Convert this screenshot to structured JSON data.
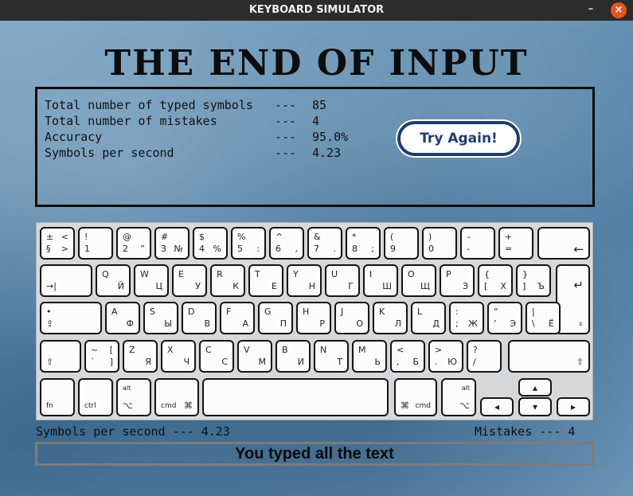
{
  "window": {
    "title": "KEYBOARD SIMULATOR",
    "minimize": "–",
    "close": "×"
  },
  "headline": "THE END OF INPUT",
  "stats": [
    {
      "label": "Total number of typed symbols",
      "sep": "---",
      "value": "85"
    },
    {
      "label": "Total number of mistakes",
      "sep": "---",
      "value": "4"
    },
    {
      "label": "Accuracy",
      "sep": "---",
      "value": "95.0%"
    },
    {
      "label": "Symbols per second",
      "sep": "---",
      "value": "4.23"
    }
  ],
  "try_again": "Try Again!",
  "footer": {
    "left": "Symbols per second --- 4.23",
    "right": "Mistakes --- 4"
  },
  "status": "You typed all the text",
  "keyboard": {
    "row1": [
      {
        "lt": "±",
        "lb": "§",
        "rt": "<",
        "rb": ">"
      },
      {
        "lt": "!",
        "lb": "1"
      },
      {
        "lt": "@",
        "lb": "2",
        "rb": "”"
      },
      {
        "lt": "#",
        "lb": "3",
        "rb": "№"
      },
      {
        "lt": "$",
        "lb": "4",
        "rb": "%"
      },
      {
        "lt": "%",
        "lb": "5",
        "rb": ":"
      },
      {
        "lt": "^",
        "lb": "6",
        "rb": ","
      },
      {
        "lt": "&",
        "lb": "7",
        "rb": "."
      },
      {
        "lt": "*",
        "lb": "8",
        "rb": ";"
      },
      {
        "lt": "(",
        "lb": "9"
      },
      {
        "lt": ")",
        "lb": "0"
      },
      {
        "lt": "–",
        "lb": "-"
      },
      {
        "lt": "+",
        "lb": "="
      }
    ],
    "backspace": "←",
    "tab": "→|",
    "row2": [
      {
        "lt": "Q",
        "rb": "Й"
      },
      {
        "lt": "W",
        "rb": "Ц"
      },
      {
        "lt": "E",
        "rb": "У"
      },
      {
        "lt": "R",
        "rb": "К"
      },
      {
        "lt": "T",
        "rb": "Е"
      },
      {
        "lt": "Y",
        "rb": "Н"
      },
      {
        "lt": "U",
        "rb": "Г"
      },
      {
        "lt": "I",
        "rb": "Ш"
      },
      {
        "lt": "O",
        "rb": "Щ"
      },
      {
        "lt": "P",
        "rb": "З"
      },
      {
        "lt": "{",
        "lb": "[",
        "rb": "Х"
      },
      {
        "lt": "}",
        "lb": "]",
        "rb": "Ъ"
      }
    ],
    "enter": "↵",
    "caps_dot": "•",
    "caps": "⇪",
    "row3": [
      {
        "lt": "A",
        "rb": "Ф"
      },
      {
        "lt": "S",
        "rb": "Ы"
      },
      {
        "lt": "D",
        "rb": "В"
      },
      {
        "lt": "F",
        "rb": "А"
      },
      {
        "lt": "G",
        "rb": "П"
      },
      {
        "lt": "H",
        "rb": "Р"
      },
      {
        "lt": "J",
        "rb": "О"
      },
      {
        "lt": "K",
        "rb": "Л"
      },
      {
        "lt": "L",
        "rb": "Д"
      },
      {
        "lt": ":",
        "lb": ";",
        "rb": "Ж"
      },
      {
        "lt": "“",
        "lb": "’",
        "rb": "Э"
      },
      {
        "lt": "|",
        "lb": "\\",
        "rb": "Ё"
      }
    ],
    "shift_l": "⇧",
    "row4": [
      {
        "lt": "~",
        "lb": "`",
        "rt": "[",
        "rb": "]"
      },
      {
        "lt": "Z",
        "rb": "Я"
      },
      {
        "lt": "X",
        "rb": "Ч"
      },
      {
        "lt": "C",
        "rb": "С"
      },
      {
        "lt": "V",
        "rb": "М"
      },
      {
        "lt": "B",
        "rb": "И"
      },
      {
        "lt": "N",
        "rb": "Т"
      },
      {
        "lt": "M",
        "rb": "Ь"
      },
      {
        "lt": "<",
        "lb": ",",
        "rb": "Б"
      },
      {
        "lt": ">",
        "lb": ".",
        "rb": "Ю"
      },
      {
        "lt": "?",
        "lb": "/"
      }
    ],
    "shift_r": "⇧",
    "fn": "fn",
    "ctrl": "ctrl",
    "alt": "alt",
    "alt_sym": "⌥",
    "cmd": "cmd",
    "cmd_sym": "⌘",
    "arrow_left": "◂",
    "arrow_right": "▸",
    "arrow_up": "▴",
    "arrow_down": "▾",
    "sub_sym": "⌅"
  }
}
